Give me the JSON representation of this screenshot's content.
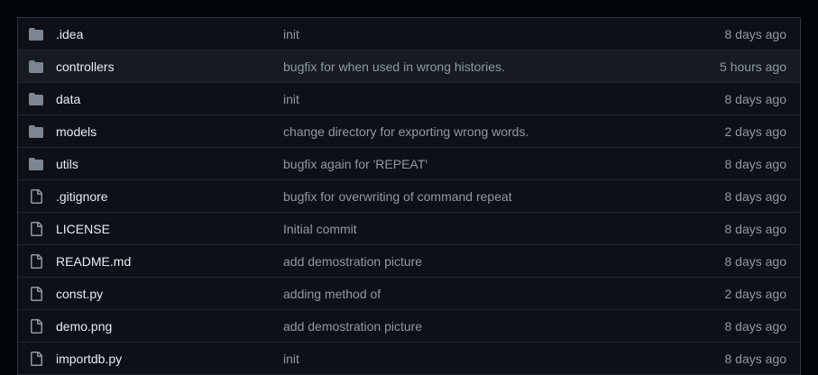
{
  "colors": {
    "page_background": "#010409",
    "table_background": "#0d1117",
    "highlight_row": "#161b22",
    "border": "#30363d",
    "folder_icon": "#7d8590",
    "file_icon": "#9198a1",
    "name_text": "#e6edf3",
    "muted_text": "#9198a1"
  },
  "files": [
    {
      "name": ".idea",
      "type": "folder",
      "icon": "folder-icon",
      "message": "init",
      "age": "8 days ago"
    },
    {
      "name": "controllers",
      "type": "folder",
      "icon": "folder-icon",
      "message": "bugfix for when used in wrong histories.",
      "age": "5 hours ago",
      "highlighted": true
    },
    {
      "name": "data",
      "type": "folder",
      "icon": "folder-icon",
      "message": "init",
      "age": "8 days ago"
    },
    {
      "name": "models",
      "type": "folder",
      "icon": "folder-icon",
      "message": "change directory for exporting wrong words.",
      "age": "2 days ago"
    },
    {
      "name": "utils",
      "type": "folder",
      "icon": "folder-icon",
      "message": "bugfix again for 'REPEAT'",
      "age": "8 days ago"
    },
    {
      "name": ".gitignore",
      "type": "file",
      "icon": "file-icon",
      "message": "bugfix for overwriting of command repeat",
      "age": "8 days ago"
    },
    {
      "name": "LICENSE",
      "type": "file",
      "icon": "file-icon",
      "message": "Initial commit",
      "age": "8 days ago"
    },
    {
      "name": "README.md",
      "type": "file",
      "icon": "file-icon",
      "message": "add demostration picture",
      "age": "8 days ago"
    },
    {
      "name": "const.py",
      "type": "file",
      "icon": "file-icon",
      "message": "adding method of",
      "age": "2 days ago"
    },
    {
      "name": "demo.png",
      "type": "file",
      "icon": "file-icon",
      "message": "add demostration picture",
      "age": "8 days ago"
    },
    {
      "name": "importdb.py",
      "type": "file",
      "icon": "file-icon",
      "message": "init",
      "age": "8 days ago"
    }
  ]
}
